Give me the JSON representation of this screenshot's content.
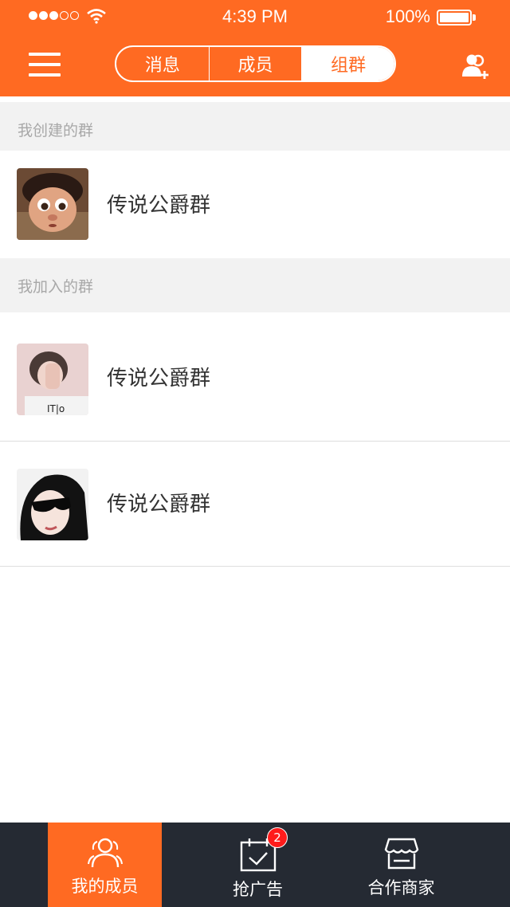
{
  "status": {
    "time": "4:39 PM",
    "battery": "100%"
  },
  "header": {
    "tabs": [
      {
        "label": "消息",
        "active": false
      },
      {
        "label": "成员",
        "active": false
      },
      {
        "label": "组群",
        "active": true
      }
    ]
  },
  "sections": {
    "created": {
      "title": "我创建的群",
      "groups": [
        {
          "name": "传说公爵群",
          "avatar": "cartoon-girl-avatar"
        }
      ]
    },
    "joined": {
      "title": "我加入的群",
      "groups": [
        {
          "name": "传说公爵群",
          "avatar": "girl-hiding-face-avatar"
        },
        {
          "name": "传说公爵群",
          "avatar": "girl-sunglasses-avatar"
        }
      ]
    }
  },
  "tabbar": {
    "items": [
      {
        "label": "我的成员",
        "icon": "members-icon",
        "active": true
      },
      {
        "label": "抢广告",
        "icon": "calendar-check-icon",
        "badge": "2"
      },
      {
        "label": "合作商家",
        "icon": "store-icon"
      }
    ]
  },
  "colors": {
    "accent": "#ff6a22",
    "tabbar_bg": "#252a33",
    "badge": "#ff1b1b"
  }
}
